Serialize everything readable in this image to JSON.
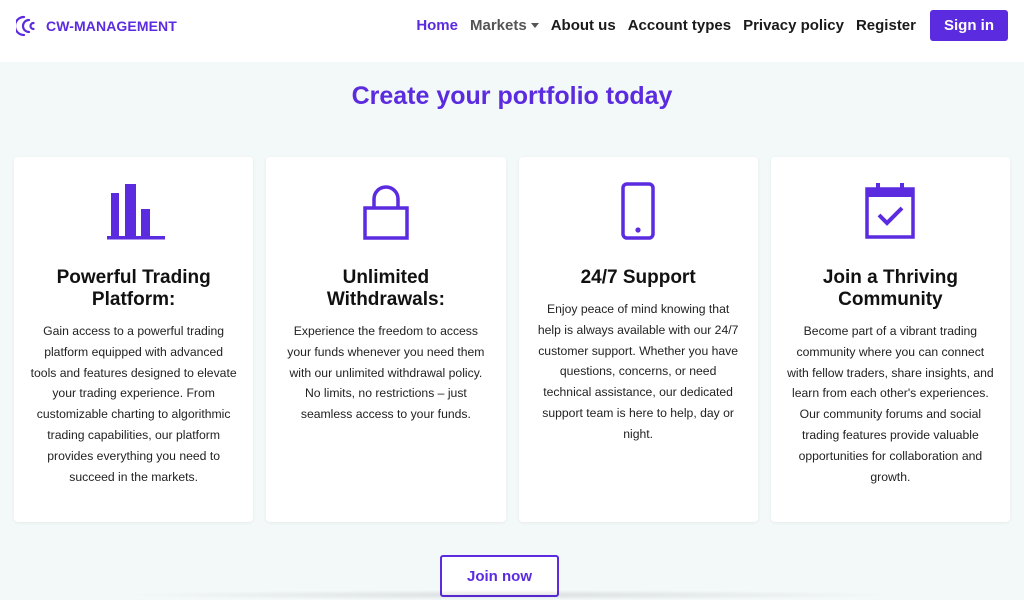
{
  "brand": {
    "name": "CW-MANAGEMENT",
    "logo_icon": "cw-logo-icon",
    "color": "#5b2be0"
  },
  "nav": {
    "home": "Home",
    "markets": "Markets",
    "about": "About us",
    "account_types": "Account types",
    "privacy": "Privacy policy",
    "register": "Register",
    "signin": "Sign in"
  },
  "main": {
    "title": "Create your portfolio today",
    "cards": [
      {
        "icon": "bar-chart-icon",
        "title": "Powerful Trading Platform:",
        "text": "Gain access to a powerful trading platform equipped with advanced tools and features designed to elevate your trading experience. From customizable charting to algorithmic trading capabilities, our platform provides everything you need to succeed in the markets."
      },
      {
        "icon": "lock-icon",
        "title": "Unlimited Withdrawals:",
        "text": "Experience the freedom to access your funds whenever you need them with our unlimited withdrawal policy. No limits, no restrictions – just seamless access to your funds."
      },
      {
        "icon": "smartphone-icon",
        "title": "24/7 Support",
        "text": "Enjoy peace of mind knowing that help is always available with our 24/7 customer support. Whether you have questions, concerns, or need technical assistance, our dedicated support team is here to help, day or night."
      },
      {
        "icon": "calendar-check-icon",
        "title": "Join a Thriving Community",
        "text": "Become part of a vibrant trading community where you can connect with fellow traders, share insights, and learn from each other's experiences. Our community forums and social trading features provide valuable opportunities for collaboration and growth."
      }
    ],
    "join_button": "Join now"
  },
  "colors": {
    "accent": "#5b2be0",
    "background": "#f3f8f8",
    "card": "#ffffff"
  }
}
